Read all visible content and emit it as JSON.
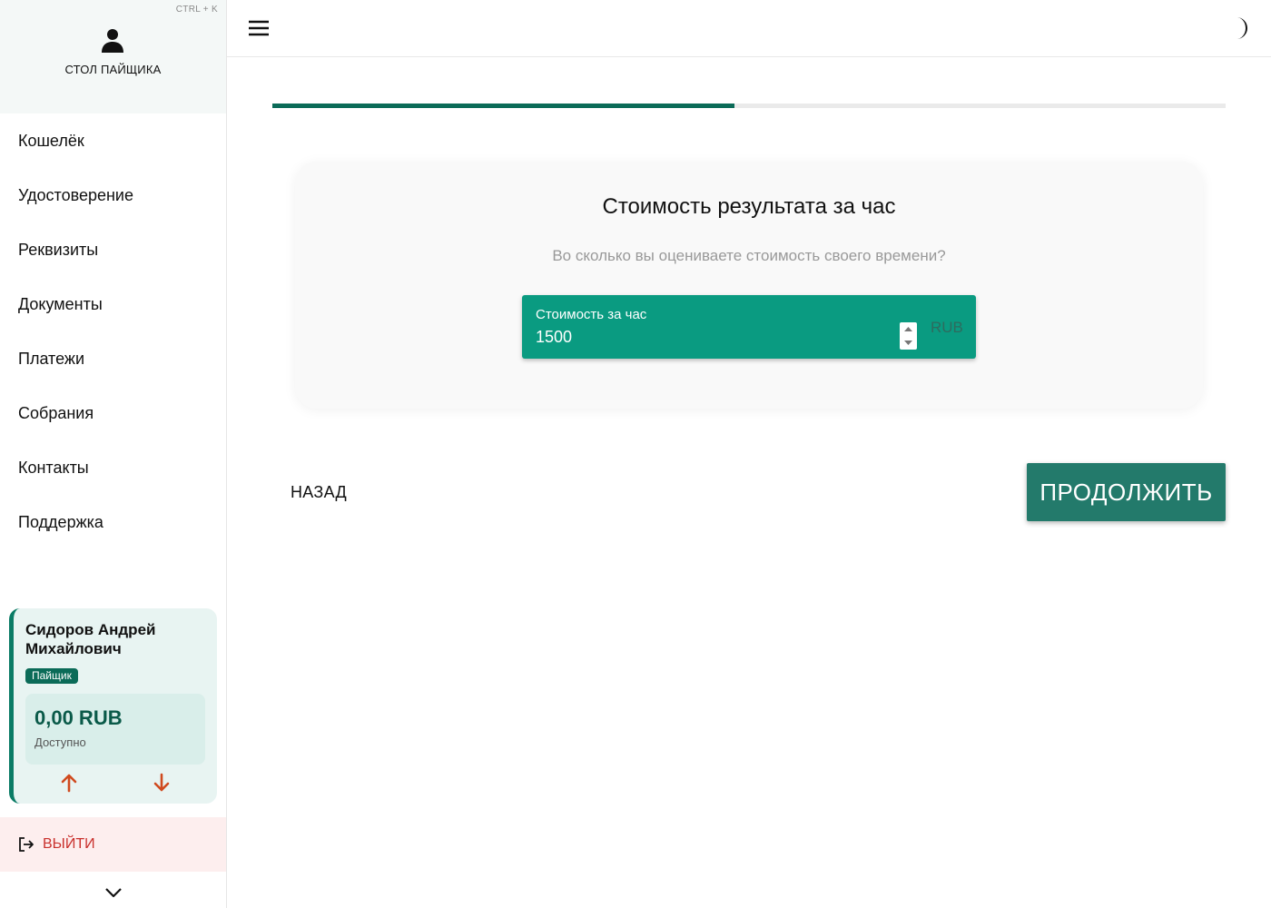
{
  "sidebar": {
    "shortcut": "CTRL + K",
    "title": "СТОЛ ПАЙЩИКА",
    "items": [
      {
        "label": "Кошелёк"
      },
      {
        "label": "Удостоверение"
      },
      {
        "label": "Реквизиты"
      },
      {
        "label": "Документы"
      },
      {
        "label": "Платежи"
      },
      {
        "label": "Собрания"
      },
      {
        "label": "Контакты"
      },
      {
        "label": "Поддержка"
      }
    ],
    "user": {
      "name": "Сидоров Андрей Михайлович",
      "role": "Пайщик",
      "balance": "0,00 RUB",
      "balance_label": "Доступно"
    },
    "logout_label": "ВЫЙТИ"
  },
  "icons": {
    "user": "user-icon",
    "menu": "hamburger-menu-icon",
    "theme": "moon-icon",
    "deposit": "arrow-up-icon",
    "withdraw": "arrow-down-icon",
    "logout": "logout-icon",
    "collapse": "chevron-down-icon"
  },
  "progress": {
    "value": 0.485
  },
  "step": {
    "title": "Стоимость результата за час",
    "subtitle": "Во сколько вы оцениваете стоимость своего времени?",
    "field": {
      "label": "Стоимость за час",
      "value": "1500",
      "suffix": "RUB"
    }
  },
  "actions": {
    "back": "НАЗАД",
    "next": "ПРОДОЛЖИТЬ"
  },
  "colors": {
    "accent": "#0b6b58",
    "field_bg": "#0a9b81",
    "button_bg": "#237a6b",
    "arrow": "#d04a1f",
    "logout_text": "#c9302c"
  }
}
